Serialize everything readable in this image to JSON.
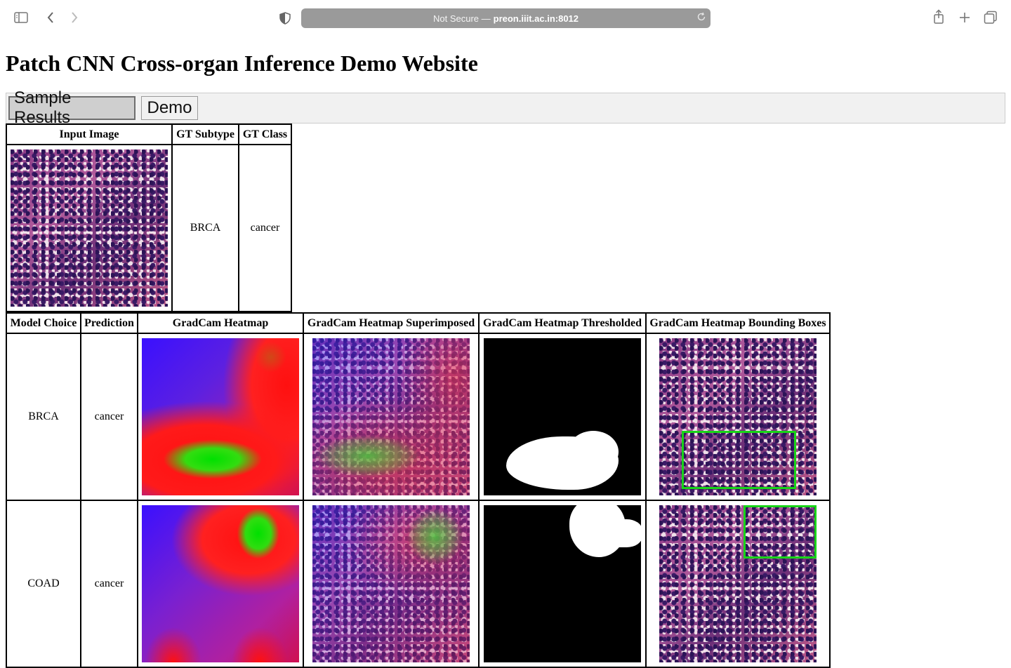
{
  "browser": {
    "address_prefix": "Not Secure —",
    "address_host": "preon.iiit.ac.in:8012"
  },
  "page": {
    "title": "Patch CNN Cross-organ Inference Demo Website",
    "tabs": [
      {
        "label": "Sample Results",
        "active": true
      },
      {
        "label": "Demo",
        "active": false
      }
    ]
  },
  "input_table": {
    "headers": [
      "Input Image",
      "GT Subtype",
      "GT Class"
    ],
    "row": {
      "gt_subtype": "BRCA",
      "gt_class": "cancer"
    }
  },
  "results_table": {
    "headers": [
      "Model Choice",
      "Prediction",
      "GradCam Heatmap",
      "GradCam Heatmap Superimposed",
      "GradCam Heatmap Thresholded",
      "GradCam Heatmap Bounding Boxes"
    ],
    "rows": [
      {
        "model": "BRCA",
        "prediction": "cancer"
      },
      {
        "model": "COAD",
        "prediction": "cancer"
      }
    ]
  },
  "icons": [
    "sidebar-icon",
    "back-icon",
    "forward-icon",
    "shield-icon",
    "reload-icon",
    "share-icon",
    "new-tab-icon",
    "tabs-overview-icon"
  ]
}
